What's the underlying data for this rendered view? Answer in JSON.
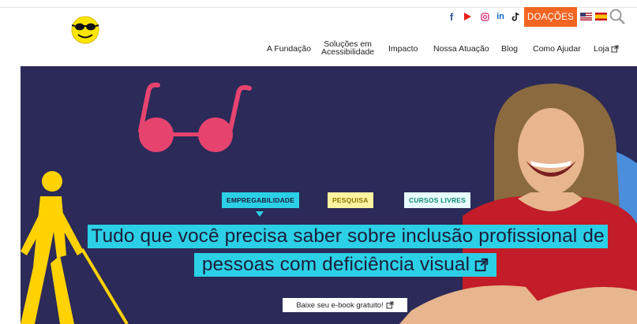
{
  "header": {
    "logo_icon": "smiley-sunglasses-icon",
    "social": [
      "facebook-icon",
      "youtube-icon",
      "instagram-icon",
      "linkedin-icon",
      "tiktok-icon"
    ],
    "donate_label": "DOAÇÕES",
    "flags": [
      "us-flag-icon",
      "spain-flag-icon"
    ],
    "search_icon": "search-icon"
  },
  "nav": {
    "items": [
      {
        "label": "A Fundação"
      },
      {
        "label_line1": "Soluções em",
        "label_line2": "Acessibilidade"
      },
      {
        "label": "Impacto"
      },
      {
        "label": "Nossa Atuação"
      },
      {
        "label": "Blog"
      },
      {
        "label": "Como Ajudar"
      },
      {
        "label": "Loja"
      }
    ],
    "external_icon": "external-link-icon"
  },
  "hero": {
    "tabs": [
      "EMPREGABILIDADE",
      "PESQUISA",
      "CURSOS LIVRES"
    ],
    "headline_line1": "Tudo que você precisa saber sobre inclusão profissional de",
    "headline_line2": "pessoas com deficiência visual",
    "ebook_label": "Baixe seu e-book gratuito!",
    "colors": {
      "background": "#2b2a58",
      "accent_cyan": "#2bd0e6",
      "accent_yellow": "#ffd200",
      "accent_pink": "#e6436f",
      "accent_orange": "#f26522"
    }
  }
}
